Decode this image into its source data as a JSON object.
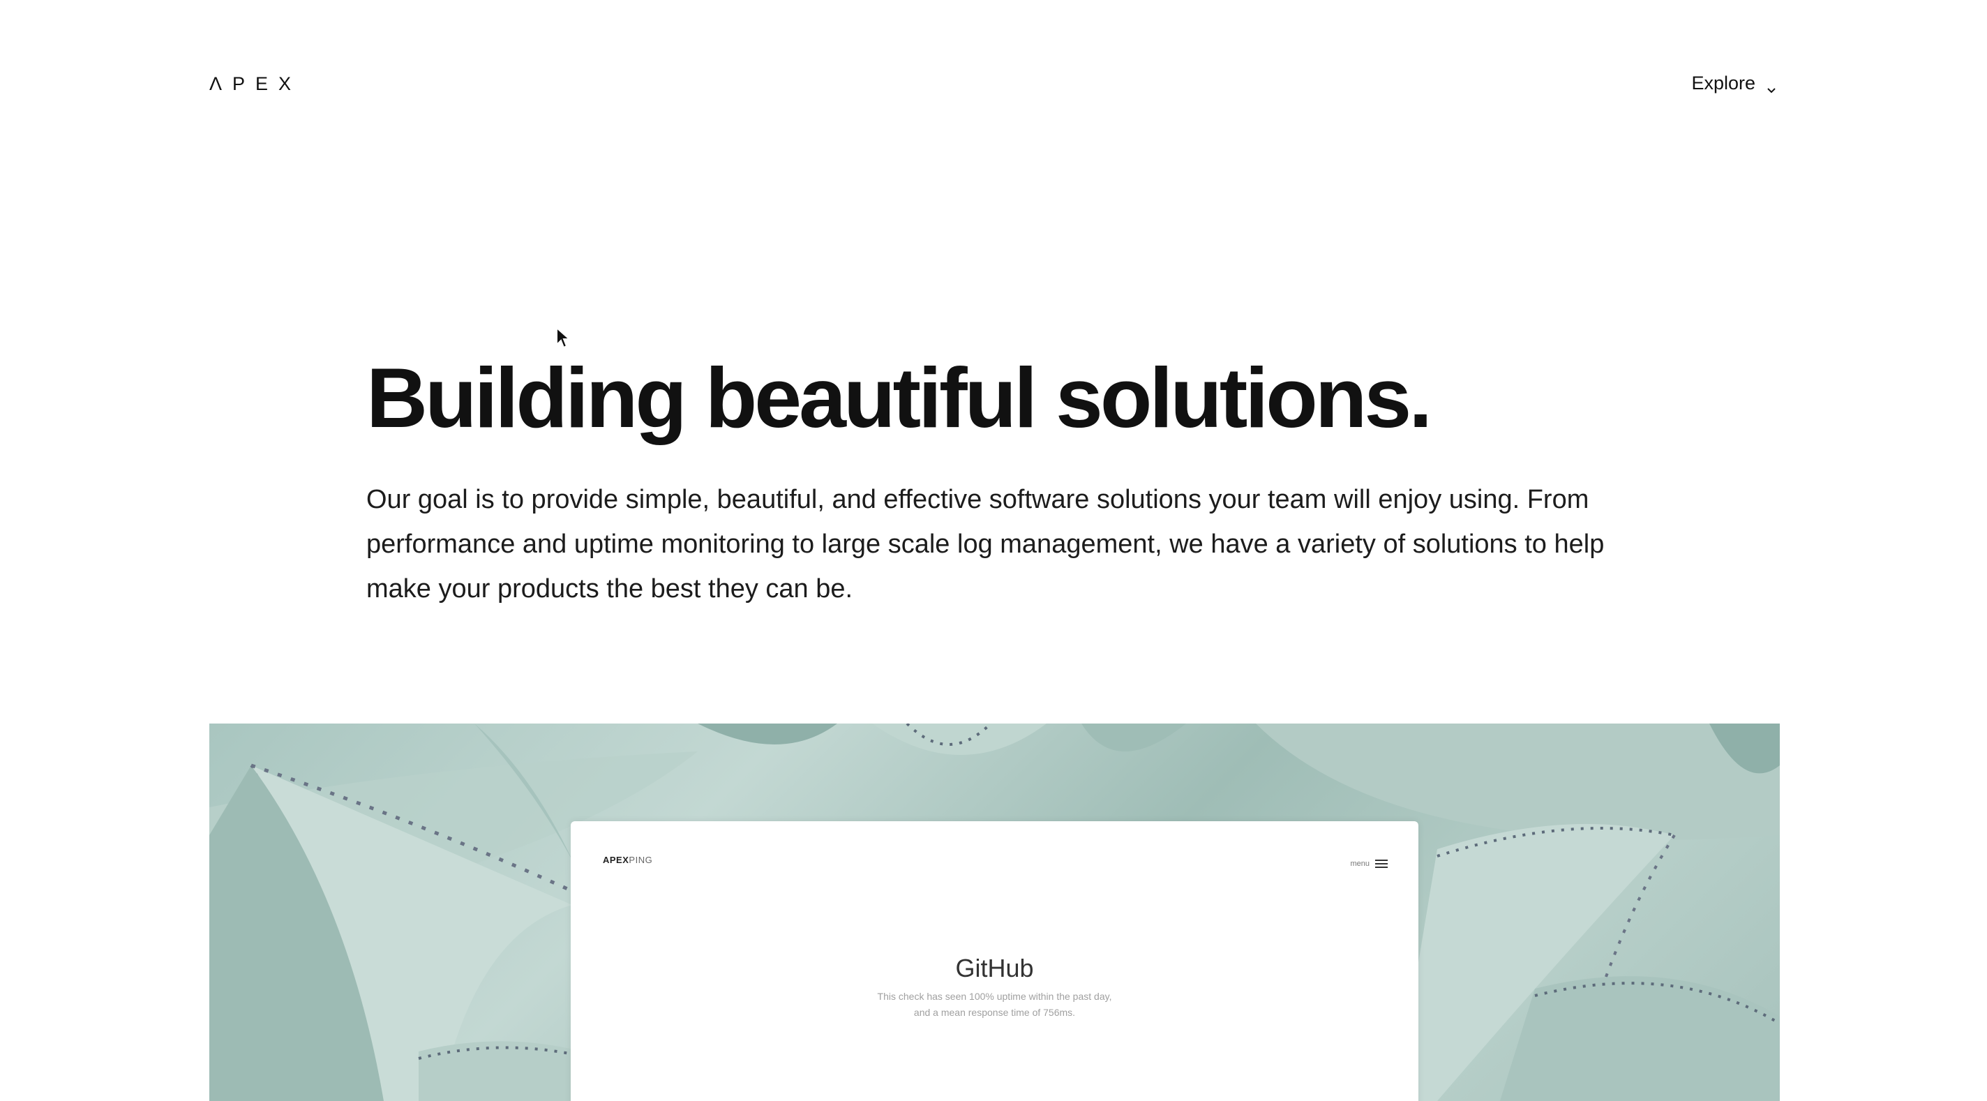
{
  "header": {
    "logo_text": "ΛPEX",
    "explore_label": "Explore",
    "explore_icon": "chevron-down-icon"
  },
  "hero": {
    "title": "Building beautiful solutions.",
    "description": "Our goal is to provide simple, beautiful, and effective software solutions your team will enjoy using. From performance and uptime monitoring to large scale log management, we have a variety of solutions to help make your products the best they can be."
  },
  "preview": {
    "image_subject": "agave plant leaves",
    "colors": {
      "leaf_light": "#c7dbd6",
      "leaf_mid": "#a9c6c0",
      "leaf_dark": "#8fb0a9",
      "leaf_edge": "#5d6b7a"
    },
    "card": {
      "logo_strong": "APEX",
      "logo_light": "PING",
      "menu_label": "menu",
      "menu_icon": "hamburger-icon",
      "title": "GitHub",
      "subtitle": "This check has seen 100% uptime within the past day, and a mean response time of 756ms."
    }
  }
}
